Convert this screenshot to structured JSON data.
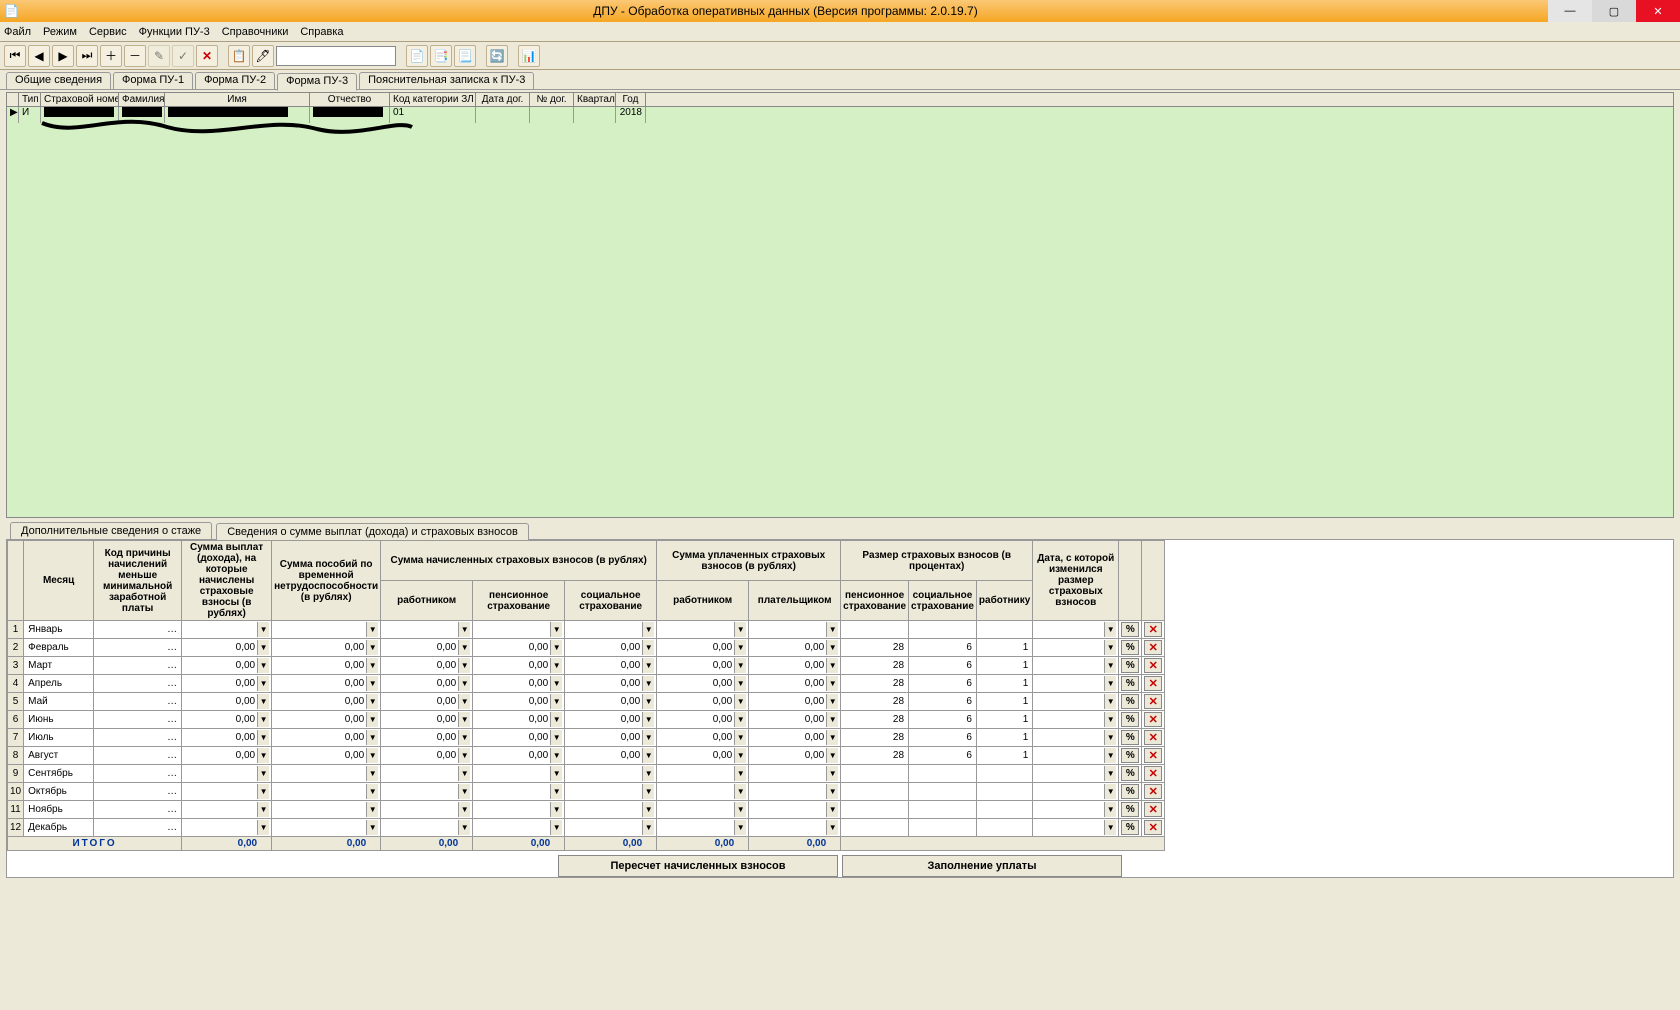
{
  "window": {
    "title": "ДПУ - Обработка оперативных данных (Версия программы: 2.0.19.7)"
  },
  "menu": {
    "file": "Файл",
    "mode": "Режим",
    "service": "Сервис",
    "funcs": "Функции ПУ-3",
    "refs": "Справочники",
    "help": "Справка"
  },
  "top_tabs": {
    "t0": "Общие сведения",
    "t1": "Форма ПУ-1",
    "t2": "Форма ПУ-2",
    "t3": "Форма ПУ-3",
    "t4": "Пояснительная записка к ПУ-3"
  },
  "upper_grid": {
    "headers": {
      "type": "Тип",
      "snum": "Страховой номер",
      "lname": "Фамилия",
      "fname": "Имя",
      "mname": "Отчество",
      "zlcode": "Код категории ЗЛ",
      "dogdate": "Дата дог.",
      "dognum": "№ дог.",
      "quarter": "Квартал",
      "year": "Год"
    },
    "row": {
      "type": "И",
      "zlcode": "01",
      "year": "2018"
    }
  },
  "lower_tabs": {
    "t0": "Дополнительные сведения о стаже",
    "t1": "Сведения о сумме выплат (дохода) и страховых взносов"
  },
  "cols": {
    "month": "Месяц",
    "reason": "Код причины начислений меньше минимальной заработной платы",
    "sum_pay": "Сумма выплат (дохода), на которые начислены страховые взносы (в рублях)",
    "benefit": "Сумма пособий по временной нетрудоспособности (в рублях)",
    "accrued_group": "Сумма начисленных страховых взносов (в рублях)",
    "worker": "работником",
    "pension": "пенсионное страхование",
    "social": "социальное страхование",
    "paid_group": "Сумма уплаченных страховых взносов (в рублях)",
    "payer": "плательщиком",
    "rate_group": "Размер страховых взносов (в процентах)",
    "rate_pension": "пенсионное страхование",
    "rate_social": "социальное страхование",
    "rate_worker": "работнику",
    "date_change": "Дата, с которой изменился размер страховых взносов"
  },
  "months": {
    "m1": "Январь",
    "m2": "Февраль",
    "m3": "Март",
    "m4": "Апрель",
    "m5": "Май",
    "m6": "Июнь",
    "m7": "Июль",
    "m8": "Август",
    "m9": "Сентябрь",
    "m10": "Октябрь",
    "m11": "Ноябрь",
    "m12": "Декабрь"
  },
  "rows": {
    "1": {
      "num": "1",
      "reason": "",
      "sum": "",
      "ben": "",
      "w": "",
      "p": "",
      "s": "",
      "pw": "",
      "pp": "",
      "rp": "",
      "rs": "",
      "rw": "",
      "dc": ""
    },
    "2": {
      "num": "2",
      "reason": "",
      "sum": "0,00",
      "ben": "0,00",
      "w": "0,00",
      "p": "0,00",
      "s": "0,00",
      "pw": "0,00",
      "pp": "0,00",
      "rp": "28",
      "rs": "6",
      "rw": "1",
      "dc": ""
    },
    "3": {
      "num": "3",
      "reason": "",
      "sum": "0,00",
      "ben": "0,00",
      "w": "0,00",
      "p": "0,00",
      "s": "0,00",
      "pw": "0,00",
      "pp": "0,00",
      "rp": "28",
      "rs": "6",
      "rw": "1",
      "dc": ""
    },
    "4": {
      "num": "4",
      "reason": "",
      "sum": "0,00",
      "ben": "0,00",
      "w": "0,00",
      "p": "0,00",
      "s": "0,00",
      "pw": "0,00",
      "pp": "0,00",
      "rp": "28",
      "rs": "6",
      "rw": "1",
      "dc": ""
    },
    "5": {
      "num": "5",
      "reason": "",
      "sum": "0,00",
      "ben": "0,00",
      "w": "0,00",
      "p": "0,00",
      "s": "0,00",
      "pw": "0,00",
      "pp": "0,00",
      "rp": "28",
      "rs": "6",
      "rw": "1",
      "dc": ""
    },
    "6": {
      "num": "6",
      "reason": "",
      "sum": "0,00",
      "ben": "0,00",
      "w": "0,00",
      "p": "0,00",
      "s": "0,00",
      "pw": "0,00",
      "pp": "0,00",
      "rp": "28",
      "rs": "6",
      "rw": "1",
      "dc": ""
    },
    "7": {
      "num": "7",
      "reason": "",
      "sum": "0,00",
      "ben": "0,00",
      "w": "0,00",
      "p": "0,00",
      "s": "0,00",
      "pw": "0,00",
      "pp": "0,00",
      "rp": "28",
      "rs": "6",
      "rw": "1",
      "dc": ""
    },
    "8": {
      "num": "8",
      "reason": "",
      "sum": "0,00",
      "ben": "0,00",
      "w": "0,00",
      "p": "0,00",
      "s": "0,00",
      "pw": "0,00",
      "pp": "0,00",
      "rp": "28",
      "rs": "6",
      "rw": "1",
      "dc": ""
    },
    "9": {
      "num": "9",
      "reason": "",
      "sum": "",
      "ben": "",
      "w": "",
      "p": "",
      "s": "",
      "pw": "",
      "pp": "",
      "rp": "",
      "rs": "",
      "rw": "",
      "dc": ""
    },
    "10": {
      "num": "10",
      "reason": "",
      "sum": "",
      "ben": "",
      "w": "",
      "p": "",
      "s": "",
      "pw": "",
      "pp": "",
      "rp": "",
      "rs": "",
      "rw": "",
      "dc": ""
    },
    "11": {
      "num": "11",
      "reason": "",
      "sum": "",
      "ben": "",
      "w": "",
      "p": "",
      "s": "",
      "pw": "",
      "pp": "",
      "rp": "",
      "rs": "",
      "rw": "",
      "dc": ""
    },
    "12": {
      "num": "12",
      "reason": "",
      "sum": "",
      "ben": "",
      "w": "",
      "p": "",
      "s": "",
      "pw": "",
      "pp": "",
      "rp": "",
      "rs": "",
      "rw": "",
      "dc": ""
    }
  },
  "totals": {
    "label": "ИТОГО",
    "sum": "0,00",
    "ben": "0,00",
    "w": "0,00",
    "p": "0,00",
    "s": "0,00",
    "pw": "0,00",
    "pp": "0,00"
  },
  "buttons": {
    "recalc": "Пересчет начисленных взносов",
    "fill": "Заполнение уплаты"
  }
}
